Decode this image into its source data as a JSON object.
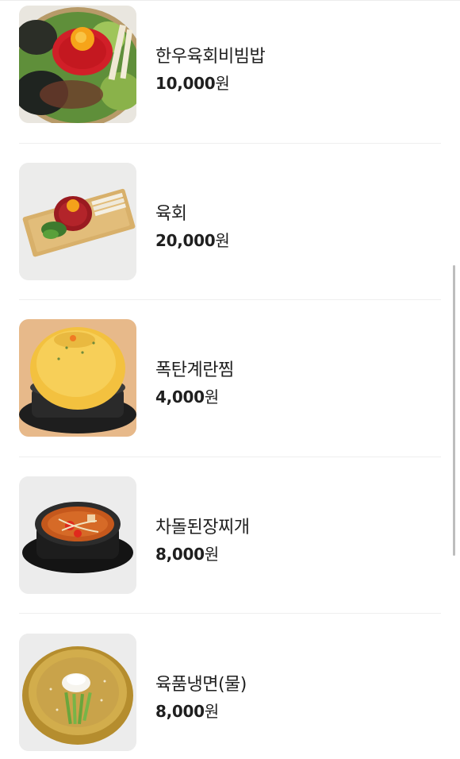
{
  "menu": {
    "currency_unit": "원",
    "items": [
      {
        "name": "한우육회비빔밥",
        "price": "10,000",
        "image_icon": "bibimbap-dish-icon"
      },
      {
        "name": "육회",
        "price": "20,000",
        "image_icon": "yukhoe-dish-icon"
      },
      {
        "name": "폭탄계란찜",
        "price": "4,000",
        "image_icon": "steamed-egg-dish-icon"
      },
      {
        "name": "차돌된장찌개",
        "price": "8,000",
        "image_icon": "doenjang-stew-dish-icon"
      },
      {
        "name": "육품냉면(물)",
        "price": "8,000",
        "image_icon": "cold-noodle-dish-icon"
      }
    ]
  },
  "scrollbar": {
    "visible": true,
    "scroll_position": 0.45
  }
}
